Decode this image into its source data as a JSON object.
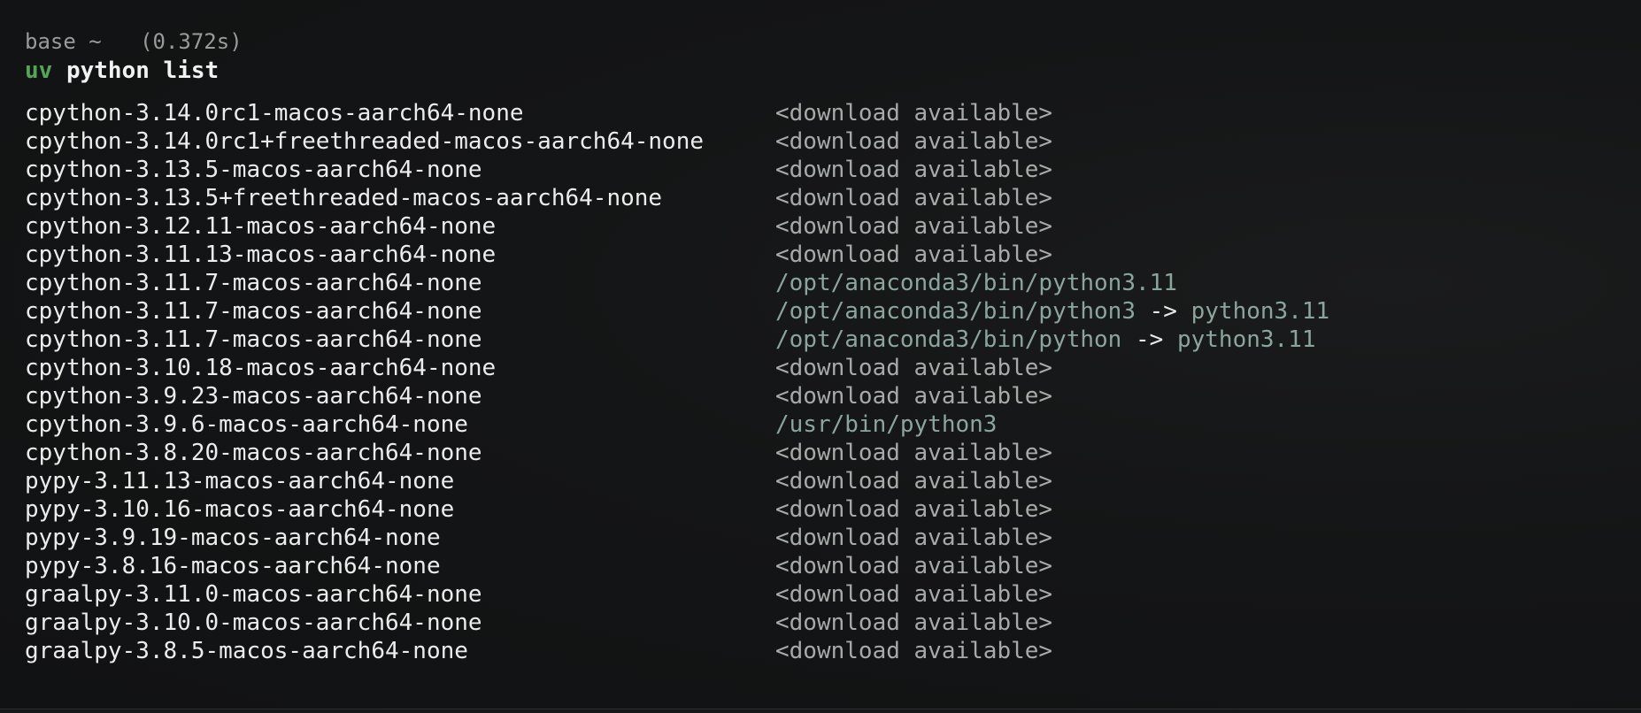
{
  "prompt": {
    "env": "base",
    "dir": "~",
    "duration": "(0.372s)"
  },
  "command": {
    "name": "uv",
    "args": "python list"
  },
  "rows": [
    {
      "name": "cpython-3.14.0rc1-macos-aarch64-none",
      "status": "<download available>",
      "path": "",
      "arrow": "",
      "target": ""
    },
    {
      "name": "cpython-3.14.0rc1+freethreaded-macos-aarch64-none",
      "status": "<download available>",
      "path": "",
      "arrow": "",
      "target": ""
    },
    {
      "name": "cpython-3.13.5-macos-aarch64-none",
      "status": "<download available>",
      "path": "",
      "arrow": "",
      "target": ""
    },
    {
      "name": "cpython-3.13.5+freethreaded-macos-aarch64-none",
      "status": "<download available>",
      "path": "",
      "arrow": "",
      "target": ""
    },
    {
      "name": "cpython-3.12.11-macos-aarch64-none",
      "status": "<download available>",
      "path": "",
      "arrow": "",
      "target": ""
    },
    {
      "name": "cpython-3.11.13-macos-aarch64-none",
      "status": "<download available>",
      "path": "",
      "arrow": "",
      "target": ""
    },
    {
      "name": "cpython-3.11.7-macos-aarch64-none",
      "status": "",
      "path": "/opt/anaconda3/bin/python3.11",
      "arrow": "",
      "target": ""
    },
    {
      "name": "cpython-3.11.7-macos-aarch64-none",
      "status": "",
      "path": "/opt/anaconda3/bin/python3",
      "arrow": " -> ",
      "target": "python3.11"
    },
    {
      "name": "cpython-3.11.7-macos-aarch64-none",
      "status": "",
      "path": "/opt/anaconda3/bin/python",
      "arrow": " -> ",
      "target": "python3.11"
    },
    {
      "name": "cpython-3.10.18-macos-aarch64-none",
      "status": "<download available>",
      "path": "",
      "arrow": "",
      "target": ""
    },
    {
      "name": "cpython-3.9.23-macos-aarch64-none",
      "status": "<download available>",
      "path": "",
      "arrow": "",
      "target": ""
    },
    {
      "name": "cpython-3.9.6-macos-aarch64-none",
      "status": "",
      "path": "/usr/bin/python3",
      "arrow": "",
      "target": ""
    },
    {
      "name": "cpython-3.8.20-macos-aarch64-none",
      "status": "<download available>",
      "path": "",
      "arrow": "",
      "target": ""
    },
    {
      "name": "pypy-3.11.13-macos-aarch64-none",
      "status": "<download available>",
      "path": "",
      "arrow": "",
      "target": ""
    },
    {
      "name": "pypy-3.10.16-macos-aarch64-none",
      "status": "<download available>",
      "path": "",
      "arrow": "",
      "target": ""
    },
    {
      "name": "pypy-3.9.19-macos-aarch64-none",
      "status": "<download available>",
      "path": "",
      "arrow": "",
      "target": ""
    },
    {
      "name": "pypy-3.8.16-macos-aarch64-none",
      "status": "<download available>",
      "path": "",
      "arrow": "",
      "target": ""
    },
    {
      "name": "graalpy-3.11.0-macos-aarch64-none",
      "status": "<download available>",
      "path": "",
      "arrow": "",
      "target": ""
    },
    {
      "name": "graalpy-3.10.0-macos-aarch64-none",
      "status": "<download available>",
      "path": "",
      "arrow": "",
      "target": ""
    },
    {
      "name": "graalpy-3.8.5-macos-aarch64-none",
      "status": "<download available>",
      "path": "",
      "arrow": "",
      "target": ""
    }
  ],
  "colors": {
    "background": "#121314",
    "command_name": "#53a653",
    "path": "#8aa69c",
    "status": "#a7aaa9",
    "meta": "#9a9a9a"
  }
}
